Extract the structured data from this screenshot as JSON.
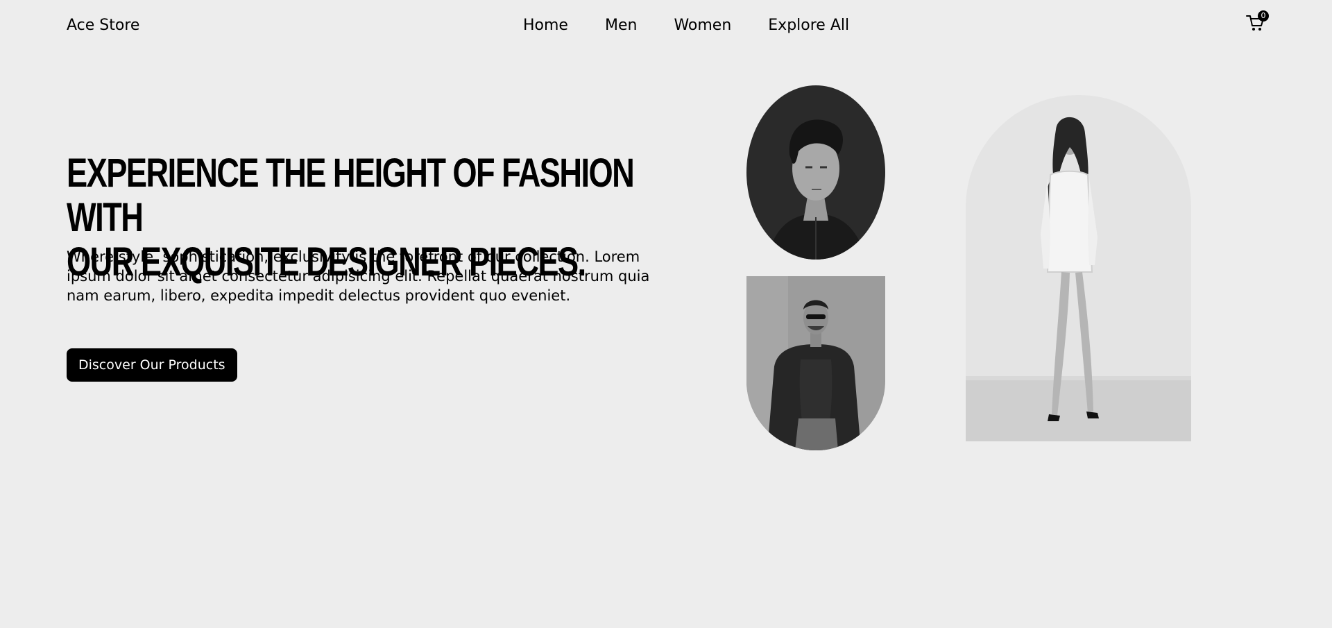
{
  "header": {
    "brand": "Ace Store",
    "nav": [
      "Home",
      "Men",
      "Women",
      "Explore All"
    ],
    "cart_count": "0",
    "cart_icon": "cart-icon"
  },
  "hero": {
    "title_line1": "EXPERIENCE THE HEIGHT OF FASHION WITH",
    "title_line2": "OUR EXQUISITE DESIGNER PIECES.",
    "description": "Where style, sophistication, exclusivity is the forefront of our collection. Lorem ipsum dolor sit amet consectetur adipisicing elit. Repellat quaerat nostrum quia nam earum, libero, expedita impedit delectus provident quo eveniet.",
    "cta_label": "Discover Our Products"
  },
  "images": {
    "portrait_man": "man-portrait-photo",
    "man_sunglasses": "man-sunglasses-photo",
    "woman_full": "woman-full-length-photo"
  },
  "colors": {
    "background": "#ededed",
    "button": "#000000",
    "text": "#000000"
  }
}
